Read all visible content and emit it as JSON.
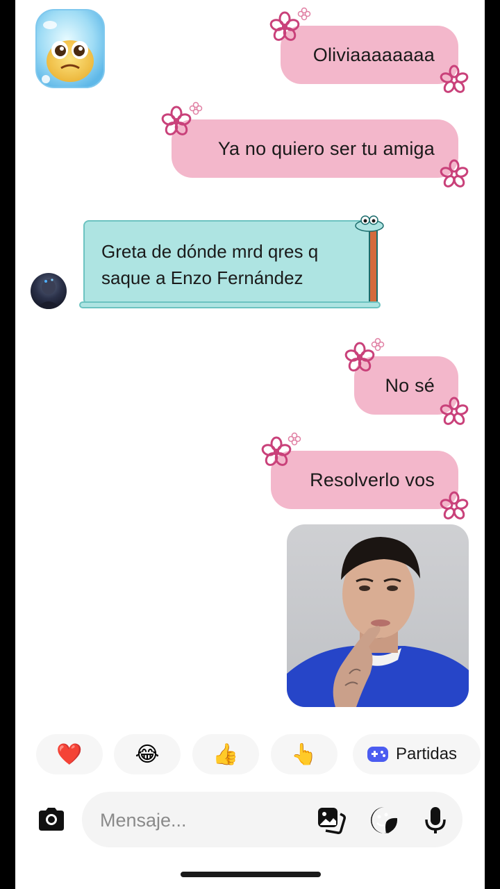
{
  "messages": {
    "out_1": "Oliviaaaaaaaa",
    "out_2": "Ya no quiero ser tu amiga",
    "in_1_line1": "Greta de dónde mrd qres q",
    "in_1_line2": "saque a Enzo Fernández",
    "out_3": "No sé",
    "out_4": "Resolverlo vos"
  },
  "reactions": [
    {
      "icon": "heart-icon",
      "glyph": "❤️"
    },
    {
      "icon": "laughing-tears-icon",
      "glyph": "😂"
    },
    {
      "icon": "thumbs-up-icon",
      "glyph": "👍"
    },
    {
      "icon": "pointing-hand-icon",
      "glyph": "👆"
    }
  ],
  "games": {
    "label": "Partidas",
    "icon": "gamepad-icon"
  },
  "composer": {
    "placeholder": "Mensaje...",
    "icons": [
      "camera-icon",
      "gallery-icon",
      "sticker-icon",
      "microphone-icon"
    ]
  },
  "colors": {
    "outgoing_bubble": "#f3b7cb",
    "incoming_bubble": "#aee4e2",
    "flower": "#c9417a",
    "games_icon": "#4b5cf0"
  }
}
